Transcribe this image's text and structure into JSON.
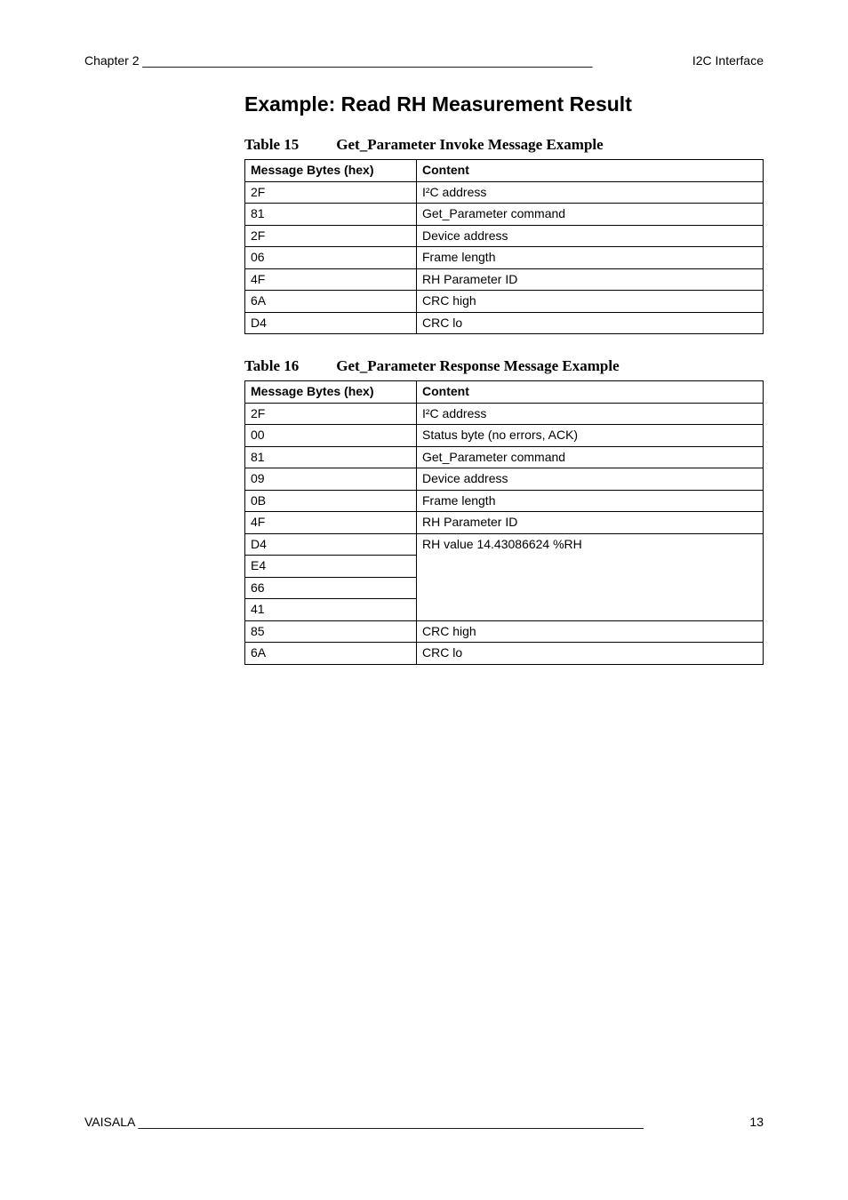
{
  "header": {
    "left": "Chapter 2 _________________________________________________________________",
    "right": "I2C Interface"
  },
  "section_title": "Example: Read RH Measurement Result",
  "table15": {
    "caption_label": "Table 15",
    "caption_title": "Get_Parameter Invoke Message Example",
    "header_bytes": "Message Bytes (hex)",
    "header_content": "Content",
    "rows": [
      {
        "bytes": "2F",
        "content": "I²C address"
      },
      {
        "bytes": "81",
        "content": "Get_Parameter command"
      },
      {
        "bytes": "2F",
        "content": "Device address"
      },
      {
        "bytes": "06",
        "content": "Frame length"
      },
      {
        "bytes": "4F",
        "content": "RH Parameter ID"
      },
      {
        "bytes": "6A",
        "content": "CRC high"
      },
      {
        "bytes": "D4",
        "content": "CRC lo"
      }
    ]
  },
  "table16": {
    "caption_label": "Table 16",
    "caption_title": "Get_Parameter Response Message Example",
    "header_bytes": "Message Bytes (hex)",
    "header_content": "Content",
    "rows": [
      {
        "bytes": "2F",
        "content": "I²C address"
      },
      {
        "bytes": "00",
        "content": "Status byte (no errors, ACK)"
      },
      {
        "bytes": "81",
        "content": "Get_Parameter command"
      },
      {
        "bytes": "09",
        "content": "Device address"
      },
      {
        "bytes": "0B",
        "content": "Frame length"
      },
      {
        "bytes": "4F",
        "content": "RH Parameter ID"
      },
      {
        "bytes": "D4",
        "content": "RH value 14.43086624  %RH",
        "merge": "start"
      },
      {
        "bytes": "E4",
        "content": "",
        "merge": "mid"
      },
      {
        "bytes": "66",
        "content": "",
        "merge": "mid"
      },
      {
        "bytes": "41",
        "content": "",
        "merge": "end"
      },
      {
        "bytes": "85",
        "content": "CRC high"
      },
      {
        "bytes": "6A",
        "content": "CRC lo"
      }
    ]
  },
  "footer": {
    "left": "VAISALA _________________________________________________________________________",
    "right": "13"
  }
}
